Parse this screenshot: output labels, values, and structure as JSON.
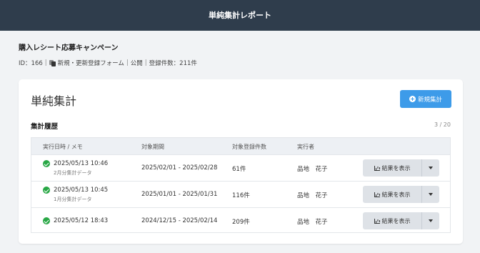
{
  "header": {
    "title": "単純集計レポート"
  },
  "campaign": {
    "title": "購入レシート応募キャンペーン",
    "id_label": "ID：166",
    "form_name": "新規・更新登録フォーム",
    "visibility": "公開",
    "entry_count": "登録件数：211件"
  },
  "card": {
    "title": "単純集計",
    "new_button": "新規集計",
    "history_title": "集計履歴",
    "history_count": "3 / 20"
  },
  "table": {
    "columns": [
      "実行日時 / メモ",
      "対象期間",
      "対象登録件数",
      "実行者"
    ],
    "rows": [
      {
        "datetime": "2025/05/13 10:46",
        "memo": "2月分集計データ",
        "period": "2025/02/01 - 2025/02/28",
        "count": "61件",
        "executor": "品地　花子",
        "action": "結果を表示"
      },
      {
        "datetime": "2025/05/13 10:45",
        "memo": "1月分集計データ",
        "period": "2025/01/01 - 2025/01/31",
        "count": "116件",
        "executor": "品地　花子",
        "action": "結果を表示"
      },
      {
        "datetime": "2025/05/12 18:43",
        "memo": "",
        "period": "2024/12/15 - 2025/02/14",
        "count": "209件",
        "executor": "品地　花子",
        "action": "結果を表示"
      }
    ]
  },
  "colors": {
    "header_bg": "#2f3d4c",
    "primary": "#3d9be9",
    "success": "#28a745"
  }
}
